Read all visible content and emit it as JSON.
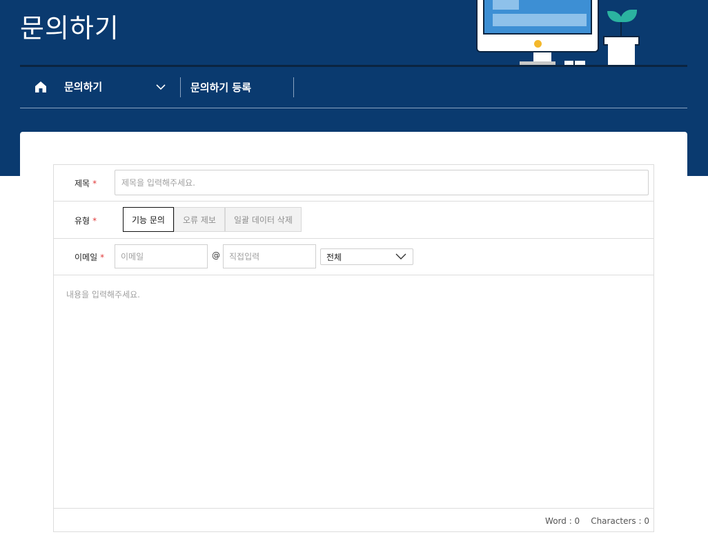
{
  "header": {
    "title": "문의하기"
  },
  "nav": {
    "home_icon": "home-icon",
    "item1_label": "문의하기",
    "item1_chevron": "chevron-down-icon",
    "item2_label": "문의하기 등록"
  },
  "form": {
    "title_label": "제목",
    "title_placeholder": "제목을 입력해주세요.",
    "required_mark": "*",
    "type_label": "유형",
    "type_options": [
      "기능 문의",
      "오류 제보",
      "일괄 데이터 삭제"
    ],
    "type_selected": "기능 문의",
    "email_label": "이메일",
    "email_local_placeholder": "이메일",
    "email_at": "@",
    "email_domain_placeholder": "직접입력",
    "email_domain_select": "전체",
    "content_placeholder": "내용을 입력해주세요.",
    "word_label": "Word : 0",
    "char_label": "Characters : 0"
  },
  "colors": {
    "hero_bg": "#0a3a6f",
    "required": "#e03a3a",
    "monitor_screen": "#3d8fd4",
    "leaf": "#2bb3a0",
    "indicator": "#f4b82c"
  }
}
